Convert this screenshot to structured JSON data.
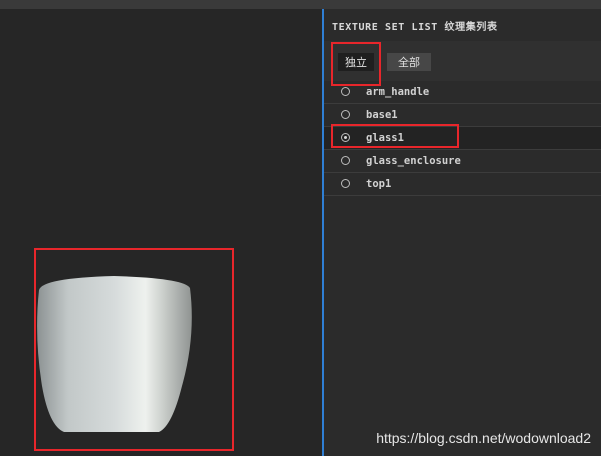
{
  "panel": {
    "title": "TEXTURE SET LIST 纹理集列表",
    "tabs": [
      {
        "label": "独立",
        "active": true
      },
      {
        "label": "全部",
        "active": false
      }
    ],
    "items": [
      {
        "label": "arm_handle",
        "selected": false
      },
      {
        "label": "base1",
        "selected": false
      },
      {
        "label": "glass1",
        "selected": true
      },
      {
        "label": "glass_enclosure",
        "selected": false
      },
      {
        "label": "top1",
        "selected": false
      }
    ]
  },
  "viewport": {
    "object_icon": "cup-model"
  },
  "watermark": "https://blog.csdn.net/wodownload2",
  "colors": {
    "annotation": "#e8262b",
    "panel_border": "#2f7fd4"
  }
}
